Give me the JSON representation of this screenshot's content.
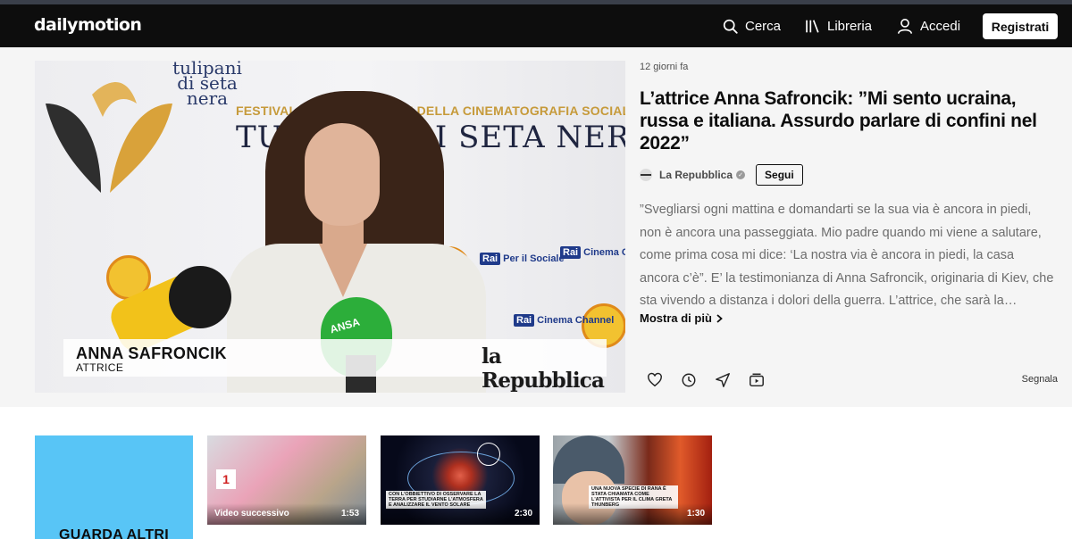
{
  "header": {
    "logo": "dailymotion",
    "search_label": "Cerca",
    "library_label": "Libreria",
    "login_label": "Accedi",
    "register_label": "Registrati"
  },
  "video": {
    "overlay_name": "ANNA SAFRONCIK",
    "overlay_role": "ATTRICE",
    "overlay_brand": "la Repubblica",
    "backdrop": {
      "brand_small": "tulipani di seta nera",
      "festival_line": "FESTIVAL INTERNAZIONALE DELLA CINEMATOGRAFIA SOCIALE",
      "festival_title": "TULIPANI DI SETA NERA",
      "sponsor_social": "Per il Sociale",
      "sponsor_cinema": "Cinema Channel",
      "mic_label": "ANSA"
    }
  },
  "info": {
    "time_ago": "12 giorni fa",
    "title": "L’attrice Anna Safroncik: ”Mi sento ucraina, russa e italiana. Assurdo parlare di confini nel 2022”",
    "channel_name": "La Repubblica",
    "follow_label": "Segui",
    "description": "”Svegliarsi ogni mattina e domandarti se la sua via è ancora in piedi, non è ancora una passeggiata. Mio padre quando mi viene a salutare, come prima cosa mi dice: ‘La nostra via è ancora in piedi, la casa ancora c’è”. E’ la testimonianza di Anna Safroncik, originaria di Kiev, che sta vivendo a distanza i dolori della guerra. L’attrice, che sarà la…",
    "more_label": "Mostra di più",
    "report_label": "Segnala",
    "actions": [
      "heart-icon",
      "clock-icon",
      "share-icon",
      "add-to-playlist-icon"
    ]
  },
  "more_card": {
    "label": "GUARDA ALTRI"
  },
  "thumbnails": [
    {
      "overlay_label": "Video successivo",
      "duration": "1:53"
    },
    {
      "overlay_label": "",
      "duration": "2:30",
      "caption": "CON L'OBBIETTIVO DI OSSERVARE LA TERRA PER STUDIARNE L'ATMOSFERA E ANALIZZARE IL VENTO SOLARE"
    },
    {
      "overlay_label": "",
      "duration": "1:30",
      "caption": "UNA NUOVA SPECIE DI RANA È STATA CHIAMATA COME L'ATTIVISTA PER IL CLIMA GRETA THUNBERG"
    }
  ],
  "colors": {
    "header_bg": "#0d0d0d",
    "hero_bg": "#f5f5f5",
    "more_card_bg": "#58c5f6"
  }
}
